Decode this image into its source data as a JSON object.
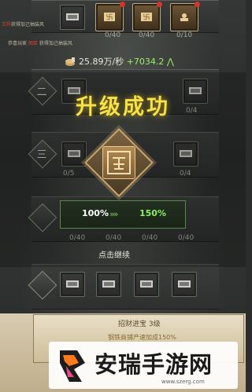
{
  "notices": {
    "line1_prefix": "王阡",
    "line1_text": "获得加己抽装风",
    "line2_prefix": "恭喜玩家",
    "line2_name": "阁臣",
    "line2_text": "获得加己抽装风"
  },
  "top_row": {
    "counts": [
      "0/40",
      "0/40",
      "0/10"
    ]
  },
  "income": {
    "value": "25.89万/秒",
    "delta": "+7034.2",
    "trend_icon": "up-chevron-icon"
  },
  "levels": {
    "two": "二",
    "three": "三"
  },
  "level_up_title": "升级成功",
  "row2": {
    "counts": [
      "0/4"
    ]
  },
  "row3": {
    "counts": [
      "0/5",
      "0/4"
    ]
  },
  "progress": {
    "current": "100%",
    "next": "150%"
  },
  "row4": {
    "counts": [
      "0/40",
      "0/40",
      "0/40",
      "0/40"
    ]
  },
  "tap_to_continue": "点击继续",
  "banner": {
    "title": "招财进宝",
    "level": "3级",
    "subtitle": "钢铁商铺产速加成150%"
  },
  "brand": {
    "name": "安瑞手游网",
    "url": "www.szerg.com"
  },
  "colors": {
    "title_yellow": "#f6e24a",
    "progress_green": "#8ff062",
    "badge_red": "#d8332b",
    "gold_border": "#c9a56a"
  }
}
